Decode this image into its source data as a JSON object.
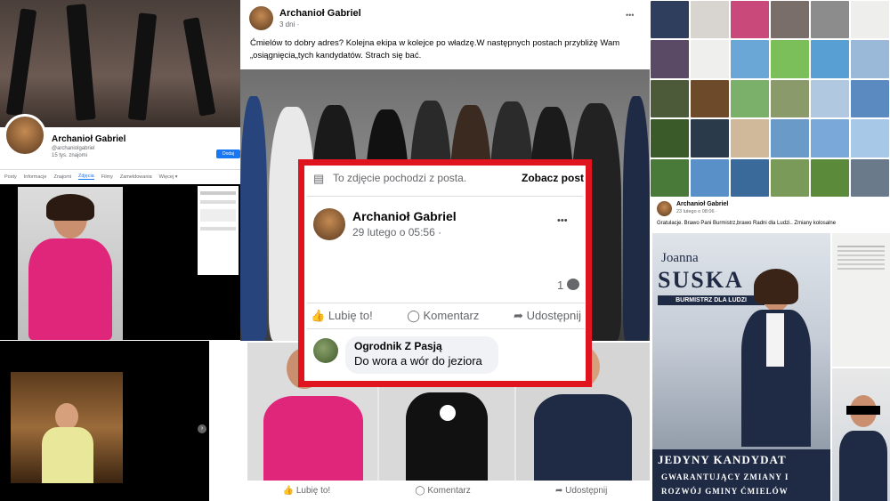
{
  "left_profile": {
    "name": "Archanioł Gabriel",
    "handle": "@archaniolgabriel",
    "friends": "15 tys. znajomi",
    "follow_label": "Dodaj",
    "tabs": [
      "Posty",
      "Informacje",
      "Znajomi",
      "Zdjęcia",
      "Filmy",
      "Zameldowania",
      "Więcej ▾"
    ],
    "active_tab": "Zdjęcia"
  },
  "center_post": {
    "author": "Archanioł Gabriel",
    "time": "3 dni ·",
    "text": "Ćmielów to dobry adres? Kolejna ekipa  w kolejce po władzę.W następnych postach przybliżę Wam „osiągnięcia„tych kandydatów. Strach się bać.",
    "more": "•••",
    "actions": {
      "like": "Lubię to!",
      "comment": "Komentarz",
      "share": "Udostępnij"
    }
  },
  "overlay": {
    "notice": "To zdjęcie pochodzi z posta.",
    "see_post": "Zobacz post",
    "author": "Archanioł Gabriel",
    "time": "29 lutego o 05:56 ·",
    "more": "•••",
    "comment_count": "1",
    "actions": {
      "like": "Lubię to!",
      "comment": "Komentarz",
      "share": "Udostępnij"
    },
    "commenter": "Ogrodnik Z Pasją",
    "comment_text": "Do wora a wór do jeziora"
  },
  "right_post": {
    "author": "Archanioł Gabriel",
    "time": "23 lutego o 08:06 ·",
    "text": "Gratulacje. Brawo Pani Burmistrz,brawo Radni dla Ludzi.. Zmiany kolosalne"
  },
  "poster": {
    "first_name": "Joanna",
    "surname": "SUSKA",
    "subtitle": "BURMISTRZ DLA LUDZI",
    "line1": "JEDYNY KANDYDAT",
    "line2": "GWARANTUJĄCY ZMIANY I",
    "line3": "ROZWÓJ GMINY ĆMIELÓW"
  },
  "colors": {
    "accent": "#1877f2",
    "frame": "#e0141e",
    "poster_navy": "#1f2a44"
  }
}
